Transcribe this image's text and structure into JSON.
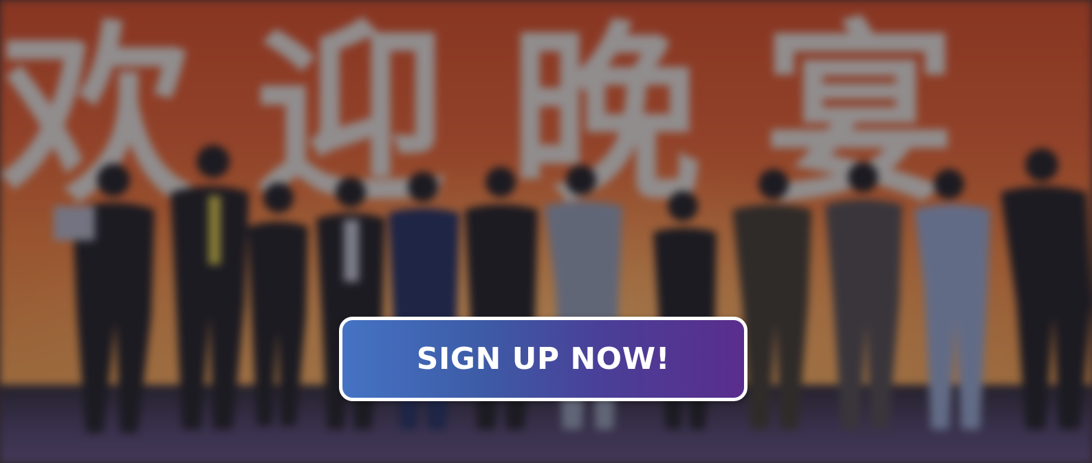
{
  "background": {
    "banner_text": [
      "欢",
      "迎",
      "晚",
      "宴"
    ]
  },
  "cta": {
    "label": "SIGN UP NOW!"
  },
  "colors": {
    "cta_start": "#4573c4",
    "cta_end": "#5a2d8c",
    "cta_border": "#ffffff",
    "banner": "#d9582a"
  }
}
